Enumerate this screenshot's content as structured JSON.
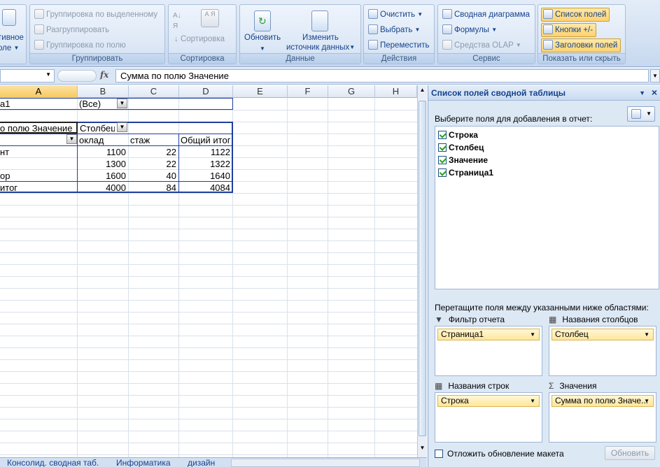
{
  "ribbon": {
    "pivot_group_partial_1": "тивное",
    "pivot_group_partial_2": "оле",
    "group_by_selection": "Группировка по выделенному",
    "ungroup": "Разгруппировать",
    "group_by_field": "Группировка по полю",
    "group_label": "Группировать",
    "sort_az_label": "А Я",
    "sort": "Сортировка",
    "sort_group_label": "Сортировка",
    "refresh": "Обновить",
    "change_source_1": "Изменить",
    "change_source_2": "источник данных",
    "data_group_label": "Данные",
    "clear": "Очистить",
    "select": "Выбрать",
    "move": "Переместить",
    "actions_group_label": "Действия",
    "pivot_chart": "Сводная диаграмма",
    "formulas": "Формулы",
    "olap_tools": "Средства OLAP",
    "service_group_label": "Сервис",
    "field_list": "Список полей",
    "buttons": "Кнопки +/-",
    "headers": "Заголовки полей",
    "show_hide_group_label": "Показать или скрыть"
  },
  "formula_bar": {
    "fx": "fx",
    "value": "Сумма по полю Значение"
  },
  "sheet": {
    "columns": [
      "A",
      "B",
      "C",
      "D",
      "E",
      "F",
      "G",
      "H"
    ],
    "page_filter_label": "а1",
    "page_filter_value": "(Все)",
    "sum_header": "о полю Значение",
    "col_header": "Столбец",
    "col_names": [
      "оклад",
      "стаж",
      "Общий итог"
    ],
    "rows": [
      {
        "label": "нт",
        "values": [
          "1100",
          "22",
          "1122"
        ]
      },
      {
        "label": "",
        "values": [
          "1300",
          "22",
          "1322"
        ]
      },
      {
        "label": "ор",
        "values": [
          "1600",
          "40",
          "1640"
        ]
      },
      {
        "label": "итог",
        "values": [
          "4000",
          "84",
          "4084"
        ]
      }
    ]
  },
  "tabs": {
    "t1": "Консолид. сводная таб.",
    "t2": "Информатика",
    "t3": "дизайн"
  },
  "pane": {
    "title": "Список полей сводной таблицы",
    "choose_label": "Выберите поля для добавления в отчет:",
    "fields": [
      "Строка",
      "Столбец",
      "Значение",
      "Страница1"
    ],
    "drag_label": "Перетащите поля между указанными ниже областями:",
    "report_filter": "Фильтр отчета",
    "column_names": "Названия столбцов",
    "row_names": "Названия строк",
    "values": "Значения",
    "filter_chip": "Страница1",
    "column_chip": "Столбец",
    "row_chip": "Строка",
    "values_chip": "Сумма по полю Значе...",
    "defer_label": "Отложить обновление макета",
    "update_button": "Обновить"
  }
}
